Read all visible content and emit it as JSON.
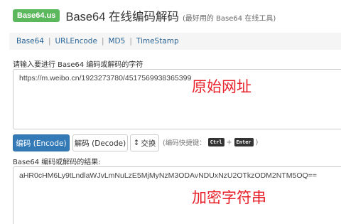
{
  "header": {
    "logo": "Base64.us",
    "title": "Base64 在线编码解码",
    "subtitle": "(最好用的 Base64 在线工具)"
  },
  "nav": {
    "items": [
      "Base64",
      "URLEncode",
      "MD5",
      "TimeStamp"
    ],
    "separator": "|"
  },
  "input": {
    "label": "请输入要进行 Base64 编码或解码的字符",
    "value": "https://m.weibo.cn/1923273780/4517569938365399",
    "overlay": "原始网址"
  },
  "toolbar": {
    "encode_label": "编码 (Encode)",
    "decode_label": "解码 (Decode)",
    "swap_icon_glyph": "↕",
    "swap_label": "交换",
    "hint_prefix": "(编码快捷键：",
    "key1": "Ctrl",
    "plus": "+",
    "key2": "Enter",
    "hint_suffix": ")"
  },
  "output": {
    "label": "Base64 编码或解码的结果:",
    "value": "aHR0cHM6Ly9tLndlaWJvLmNuLzE5MjMyNzM3ODAvNDUxNzU2OTkzODM2NTM5OQ==",
    "overlay": "加密字符串"
  }
}
